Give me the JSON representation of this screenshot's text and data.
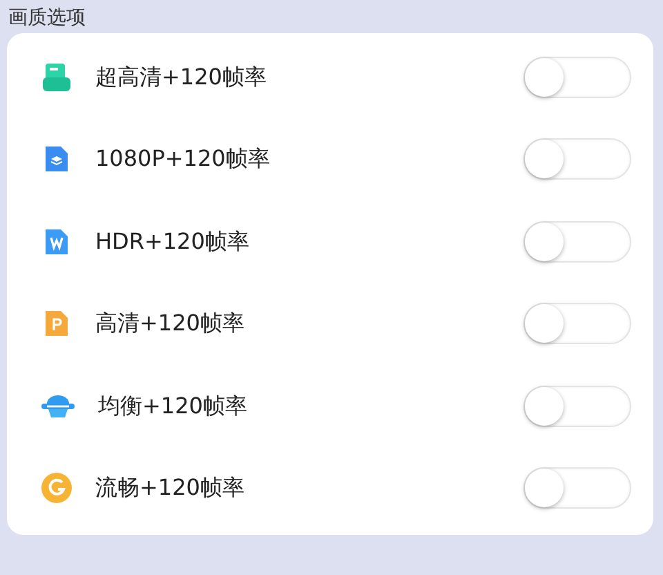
{
  "section_title": "画质选项",
  "options": [
    {
      "label": "超高清+120帧率",
      "on": false
    },
    {
      "label": "1080P+120帧率",
      "on": false
    },
    {
      "label": "HDR+120帧率",
      "on": false
    },
    {
      "label": "高清+120帧率",
      "on": false
    },
    {
      "label": "均衡+120帧率",
      "on": false
    },
    {
      "label": "流畅+120帧率",
      "on": false
    }
  ]
}
